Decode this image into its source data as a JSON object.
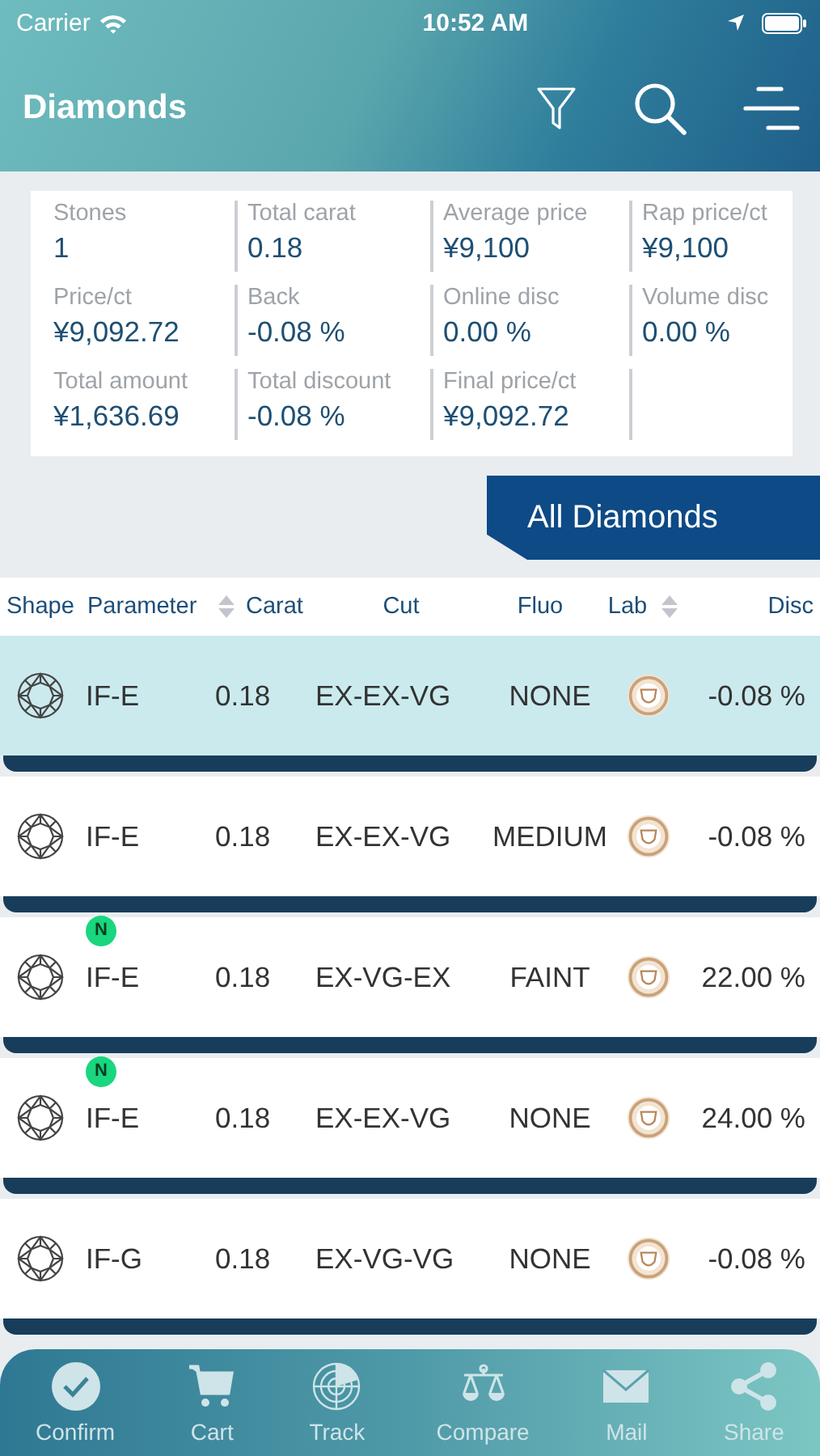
{
  "status_bar": {
    "carrier": "Carrier",
    "time": "10:52 AM"
  },
  "header": {
    "title": "Diamonds"
  },
  "summary": [
    {
      "label": "Stones",
      "value": "1"
    },
    {
      "label": "Total carat",
      "value": "0.18"
    },
    {
      "label": "Average price",
      "value": "¥9,100"
    },
    {
      "label": "Rap price/ct",
      "value": "¥9,100"
    },
    {
      "label": "Price/ct",
      "value": "¥9,092.72"
    },
    {
      "label": "Back",
      "value": "-0.08 %"
    },
    {
      "label": "Online disc",
      "value": "0.00 %"
    },
    {
      "label": "Volume disc",
      "value": "0.00 %"
    },
    {
      "label": "Total amount",
      "value": "¥1,636.69"
    },
    {
      "label": "Total discount",
      "value": "-0.08 %"
    },
    {
      "label": "Final price/ct",
      "value": "¥9,092.72"
    }
  ],
  "section_tab": {
    "label": "All Diamonds"
  },
  "table": {
    "columns": [
      {
        "label": "Shape",
        "sortable": false
      },
      {
        "label": "Parameter",
        "sortable": true
      },
      {
        "label": "Carat",
        "sortable": false
      },
      {
        "label": "Cut",
        "sortable": false
      },
      {
        "label": "Fluo",
        "sortable": false
      },
      {
        "label": "Lab",
        "sortable": true
      },
      {
        "label": "Disc",
        "sortable": false
      }
    ],
    "rows": [
      {
        "selected": true,
        "new_badge": null,
        "parameter": "IF-E",
        "carat": "0.18",
        "cut": "EX-EX-VG",
        "fluo": "NONE",
        "disc": "-0.08 %"
      },
      {
        "selected": false,
        "new_badge": null,
        "parameter": "IF-E",
        "carat": "0.18",
        "cut": "EX-EX-VG",
        "fluo": "MEDIUM",
        "disc": "-0.08 %"
      },
      {
        "selected": false,
        "new_badge": "N",
        "parameter": "IF-E",
        "carat": "0.18",
        "cut": "EX-VG-EX",
        "fluo": "FAINT",
        "disc": "22.00 %"
      },
      {
        "selected": false,
        "new_badge": "N",
        "parameter": "IF-E",
        "carat": "0.18",
        "cut": "EX-EX-VG",
        "fluo": "NONE",
        "disc": "24.00 %"
      },
      {
        "selected": false,
        "new_badge": null,
        "parameter": "IF-G",
        "carat": "0.18",
        "cut": "EX-VG-VG",
        "fluo": "NONE",
        "disc": "-0.08 %"
      }
    ]
  },
  "toolbar": [
    {
      "label": "Confirm"
    },
    {
      "label": "Cart"
    },
    {
      "label": "Track"
    },
    {
      "label": "Compare"
    },
    {
      "label": "Mail"
    },
    {
      "label": "Share"
    }
  ]
}
